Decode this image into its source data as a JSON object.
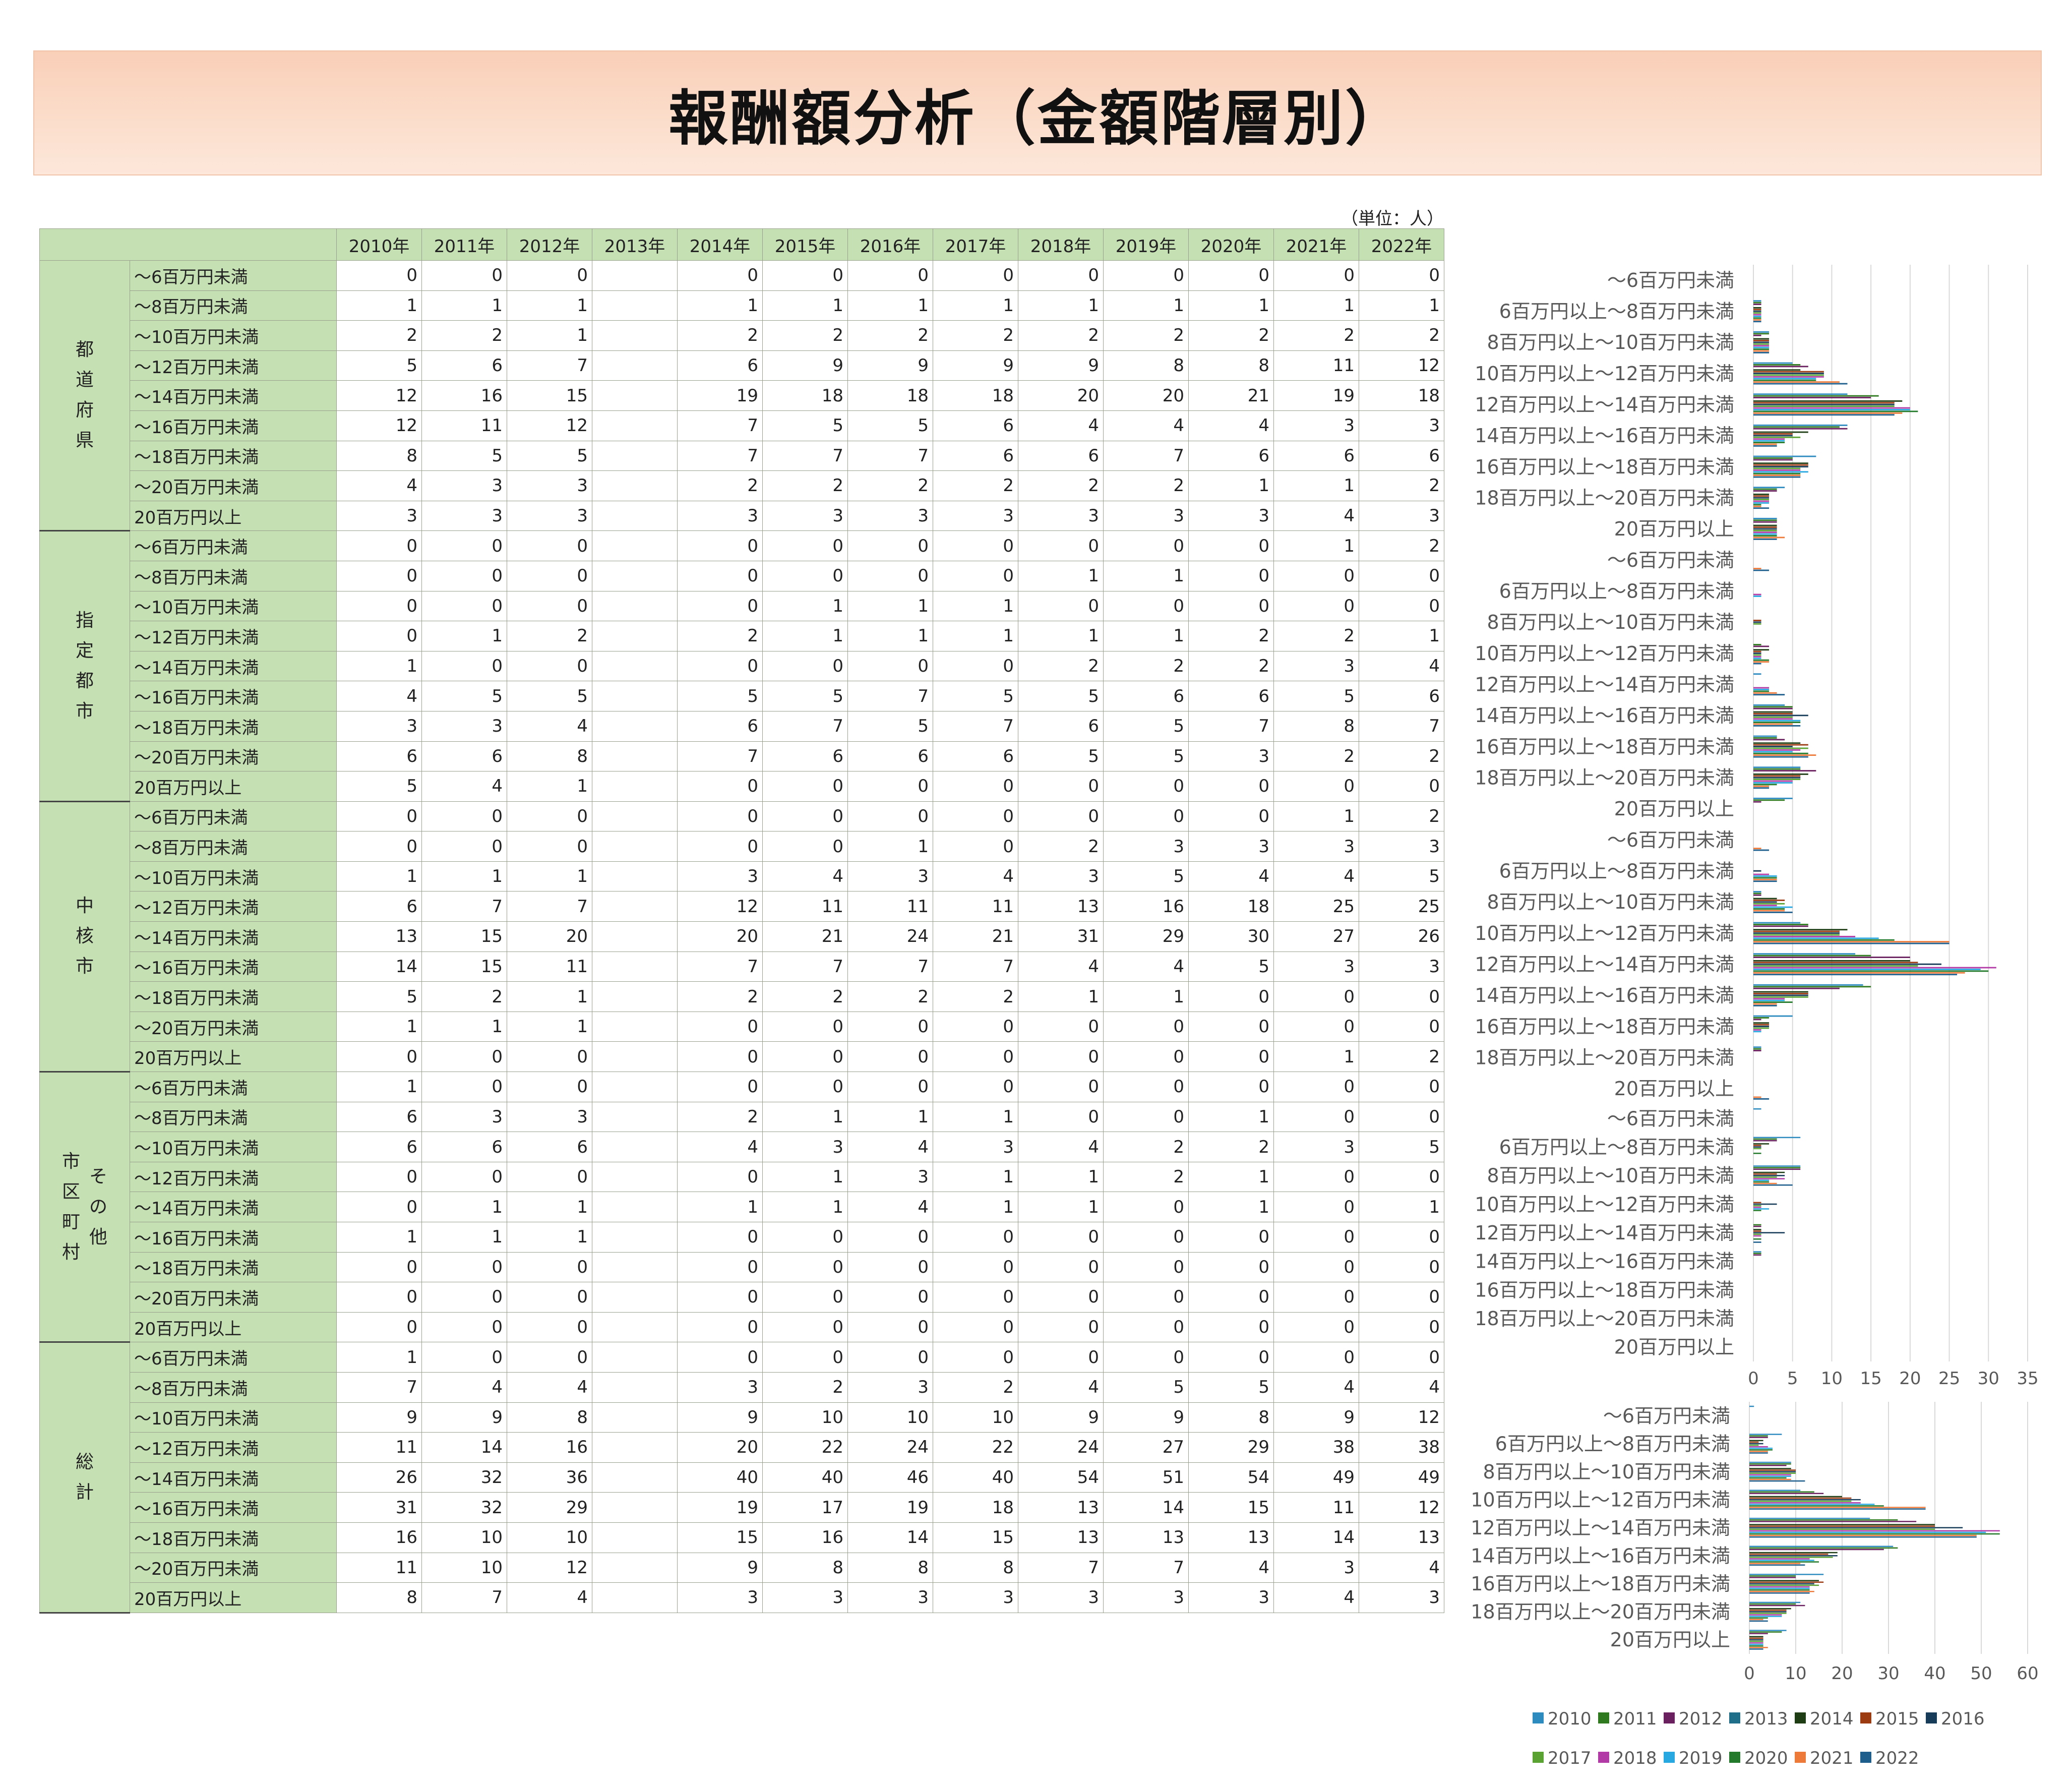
{
  "title": "報酬額分析（金額階層別）",
  "unit_note": "（単位：人）",
  "table": {
    "years": [
      "2010年",
      "2011年",
      "2012年",
      "2013年",
      "2014年",
      "2015年",
      "2016年",
      "2017年",
      "2018年",
      "2019年",
      "2020年",
      "2021年",
      "2022年"
    ],
    "regions": [
      {
        "label": "都道府県",
        "lines": [
          "都",
          "道",
          "府",
          "県"
        ],
        "bands": [
          "～6百万円未満",
          "～8百万円未満",
          "～10百万円未満",
          "～12百万円未満",
          "～14百万円未満",
          "～16百万円未満",
          "～18百万円未満",
          "～20百万円未満",
          "20百万円以上"
        ],
        "rows": [
          [
            "0",
            "0",
            "0",
            "",
            "0",
            "0",
            "0",
            "0",
            "0",
            "0",
            "0",
            "0",
            "0"
          ],
          [
            "1",
            "1",
            "1",
            "",
            "1",
            "1",
            "1",
            "1",
            "1",
            "1",
            "1",
            "1",
            "1"
          ],
          [
            "2",
            "2",
            "1",
            "",
            "2",
            "2",
            "2",
            "2",
            "2",
            "2",
            "2",
            "2",
            "2"
          ],
          [
            "5",
            "6",
            "7",
            "",
            "6",
            "9",
            "9",
            "9",
            "9",
            "8",
            "8",
            "11",
            "12"
          ],
          [
            "12",
            "16",
            "15",
            "",
            "19",
            "18",
            "18",
            "18",
            "20",
            "20",
            "21",
            "19",
            "18"
          ],
          [
            "12",
            "11",
            "12",
            "",
            "7",
            "5",
            "5",
            "6",
            "4",
            "4",
            "4",
            "3",
            "3"
          ],
          [
            "8",
            "5",
            "5",
            "",
            "7",
            "7",
            "7",
            "6",
            "6",
            "7",
            "6",
            "6",
            "6"
          ],
          [
            "4",
            "3",
            "3",
            "",
            "2",
            "2",
            "2",
            "2",
            "2",
            "2",
            "1",
            "1",
            "2"
          ],
          [
            "3",
            "3",
            "3",
            "",
            "3",
            "3",
            "3",
            "3",
            "3",
            "3",
            "3",
            "4",
            "3"
          ]
        ]
      },
      {
        "label": "指定都市",
        "lines": [
          "指",
          "定",
          "都",
          "市"
        ],
        "bands": [
          "～6百万円未満",
          "～8百万円未満",
          "～10百万円未満",
          "～12百万円未満",
          "～14百万円未満",
          "～16百万円未満",
          "～18百万円未満",
          "～20百万円未満",
          "20百万円以上"
        ],
        "rows": [
          [
            "0",
            "0",
            "0",
            "",
            "0",
            "0",
            "0",
            "0",
            "0",
            "0",
            "0",
            "1",
            "2"
          ],
          [
            "0",
            "0",
            "0",
            "",
            "0",
            "0",
            "0",
            "0",
            "1",
            "1",
            "0",
            "0",
            "0"
          ],
          [
            "0",
            "0",
            "0",
            "",
            "0",
            "1",
            "1",
            "1",
            "0",
            "0",
            "0",
            "0",
            "0"
          ],
          [
            "0",
            "1",
            "2",
            "",
            "2",
            "1",
            "1",
            "1",
            "1",
            "1",
            "2",
            "2",
            "1"
          ],
          [
            "1",
            "0",
            "0",
            "",
            "0",
            "0",
            "0",
            "0",
            "2",
            "2",
            "2",
            "3",
            "4"
          ],
          [
            "4",
            "5",
            "5",
            "",
            "5",
            "5",
            "7",
            "5",
            "5",
            "6",
            "6",
            "5",
            "6"
          ],
          [
            "3",
            "3",
            "4",
            "",
            "6",
            "7",
            "5",
            "7",
            "6",
            "5",
            "7",
            "8",
            "7"
          ],
          [
            "6",
            "6",
            "8",
            "",
            "7",
            "6",
            "6",
            "6",
            "5",
            "5",
            "3",
            "2",
            "2"
          ],
          [
            "5",
            "4",
            "1",
            "",
            "0",
            "0",
            "0",
            "0",
            "0",
            "0",
            "0",
            "0",
            "0"
          ]
        ]
      },
      {
        "label": "中核市",
        "lines": [
          "中",
          "核",
          "市"
        ],
        "bands": [
          "～6百万円未満",
          "～8百万円未満",
          "～10百万円未満",
          "～12百万円未満",
          "～14百万円未満",
          "～16百万円未満",
          "～18百万円未満",
          "～20百万円未満",
          "20百万円以上"
        ],
        "rows": [
          [
            "0",
            "0",
            "0",
            "",
            "0",
            "0",
            "0",
            "0",
            "0",
            "0",
            "0",
            "1",
            "2"
          ],
          [
            "0",
            "0",
            "0",
            "",
            "0",
            "0",
            "1",
            "0",
            "2",
            "3",
            "3",
            "3",
            "3"
          ],
          [
            "1",
            "1",
            "1",
            "",
            "3",
            "4",
            "3",
            "4",
            "3",
            "5",
            "4",
            "4",
            "5"
          ],
          [
            "6",
            "7",
            "7",
            "",
            "12",
            "11",
            "11",
            "11",
            "13",
            "16",
            "18",
            "25",
            "25"
          ],
          [
            "13",
            "15",
            "20",
            "",
            "20",
            "21",
            "24",
            "21",
            "31",
            "29",
            "30",
            "27",
            "26"
          ],
          [
            "14",
            "15",
            "11",
            "",
            "7",
            "7",
            "7",
            "7",
            "4",
            "4",
            "5",
            "3",
            "3"
          ],
          [
            "5",
            "2",
            "1",
            "",
            "2",
            "2",
            "2",
            "2",
            "1",
            "1",
            "0",
            "0",
            "0"
          ],
          [
            "1",
            "1",
            "1",
            "",
            "0",
            "0",
            "0",
            "0",
            "0",
            "0",
            "0",
            "0",
            "0"
          ],
          [
            "0",
            "0",
            "0",
            "",
            "0",
            "0",
            "0",
            "0",
            "0",
            "0",
            "0",
            "1",
            "2"
          ]
        ]
      },
      {
        "label": "市区町村その他",
        "lines": [
          "市",
          "区",
          "町",
          "村"
        ],
        "lines2": [
          "そ",
          "の",
          "他"
        ],
        "bands": [
          "～6百万円未満",
          "～8百万円未満",
          "～10百万円未満",
          "～12百万円未満",
          "～14百万円未満",
          "～16百万円未満",
          "～18百万円未満",
          "～20百万円未満",
          "20百万円以上"
        ],
        "rows": [
          [
            "1",
            "0",
            "0",
            "",
            "0",
            "0",
            "0",
            "0",
            "0",
            "0",
            "0",
            "0",
            "0"
          ],
          [
            "6",
            "3",
            "3",
            "",
            "2",
            "1",
            "1",
            "1",
            "0",
            "0",
            "1",
            "0",
            "0"
          ],
          [
            "6",
            "6",
            "6",
            "",
            "4",
            "3",
            "4",
            "3",
            "4",
            "2",
            "2",
            "3",
            "5"
          ],
          [
            "0",
            "0",
            "0",
            "",
            "0",
            "1",
            "3",
            "1",
            "1",
            "2",
            "1",
            "0",
            "0"
          ],
          [
            "0",
            "1",
            "1",
            "",
            "1",
            "1",
            "4",
            "1",
            "1",
            "0",
            "1",
            "0",
            "1"
          ],
          [
            "1",
            "1",
            "1",
            "",
            "0",
            "0",
            "0",
            "0",
            "0",
            "0",
            "0",
            "0",
            "0"
          ],
          [
            "0",
            "0",
            "0",
            "",
            "0",
            "0",
            "0",
            "0",
            "0",
            "0",
            "0",
            "0",
            "0"
          ],
          [
            "0",
            "0",
            "0",
            "",
            "0",
            "0",
            "0",
            "0",
            "0",
            "0",
            "0",
            "0",
            "0"
          ],
          [
            "0",
            "0",
            "0",
            "",
            "0",
            "0",
            "0",
            "0",
            "0",
            "0",
            "0",
            "0",
            "0"
          ]
        ]
      },
      {
        "label": "総計",
        "lines": [
          "総",
          "計"
        ],
        "bands": [
          "～6百万円未満",
          "～8百万円未満",
          "～10百万円未満",
          "～12百万円未満",
          "～14百万円未満",
          "～16百万円未満",
          "～18百万円未満",
          "～20百万円未満",
          "20百万円以上"
        ],
        "rows": [
          [
            "1",
            "0",
            "0",
            "",
            "0",
            "0",
            "0",
            "0",
            "0",
            "0",
            "0",
            "0",
            "0"
          ],
          [
            "7",
            "4",
            "4",
            "",
            "3",
            "2",
            "3",
            "2",
            "4",
            "5",
            "5",
            "4",
            "4"
          ],
          [
            "9",
            "9",
            "8",
            "",
            "9",
            "10",
            "10",
            "10",
            "9",
            "9",
            "8",
            "9",
            "12"
          ],
          [
            "11",
            "14",
            "16",
            "",
            "20",
            "22",
            "24",
            "22",
            "24",
            "27",
            "29",
            "38",
            "38"
          ],
          [
            "26",
            "32",
            "36",
            "",
            "40",
            "40",
            "46",
            "40",
            "54",
            "51",
            "54",
            "49",
            "49"
          ],
          [
            "31",
            "32",
            "29",
            "",
            "19",
            "17",
            "19",
            "18",
            "13",
            "14",
            "15",
            "11",
            "12"
          ],
          [
            "16",
            "10",
            "10",
            "",
            "15",
            "16",
            "14",
            "15",
            "13",
            "13",
            "13",
            "14",
            "13"
          ],
          [
            "11",
            "10",
            "12",
            "",
            "9",
            "8",
            "8",
            "8",
            "7",
            "7",
            "4",
            "3",
            "4"
          ],
          [
            "8",
            "7",
            "4",
            "",
            "3",
            "3",
            "3",
            "3",
            "3",
            "3",
            "3",
            "4",
            "3"
          ]
        ]
      }
    ]
  },
  "chart_data": [
    {
      "type": "bar",
      "orientation": "horizontal",
      "panel": "都道府県",
      "categories": [
        "～6百万円未満",
        "6百万円以上～8百万円未満",
        "8百万円以上～10百万円未満",
        "10百万円以上～12百万円未満",
        "12百万円以上～14百万円未満",
        "14百万円以上～16百万円未満",
        "16百万円以上～18百万円未満",
        "18百万円以上～20百万円未満",
        "20百万円以上"
      ],
      "xlim": [
        0,
        35
      ],
      "xticks": [
        0,
        5,
        10,
        15,
        20,
        25,
        30,
        35
      ],
      "show_tick_labels": true,
      "grid": true
    },
    {
      "type": "bar",
      "orientation": "horizontal",
      "panel": "指定都市",
      "categories": [
        "～6百万円未満",
        "6百万円以上～8百万円未満",
        "8百万円以上～10百万円未満",
        "10百万円以上～12百万円未満",
        "12百万円以上～14百万円未満",
        "14百万円以上～16百万円未満",
        "16百万円以上～18百万円未満",
        "18百万円以上～20百万円未満",
        "20百万円以上"
      ],
      "xlim": [
        0,
        35
      ],
      "xticks": [
        0,
        5,
        10,
        15,
        20,
        25,
        30,
        35
      ],
      "show_tick_labels": false,
      "grid": true
    },
    {
      "type": "bar",
      "orientation": "horizontal",
      "panel": "中核市",
      "categories": [
        "～6百万円未満",
        "6百万円以上～8百万円未満",
        "8百万円以上～10百万円未満",
        "10百万円以上～12百万円未満",
        "12百万円以上～14百万円未満",
        "14百万円以上～16百万円未満",
        "16百万円以上～18百万円未満",
        "18百万円以上～20百万円未満",
        "20百万円以上"
      ],
      "xlim": [
        0,
        35
      ],
      "xticks": [
        0,
        5,
        10,
        15,
        20,
        25,
        30,
        35
      ],
      "show_tick_labels": false,
      "grid": true
    },
    {
      "type": "bar",
      "orientation": "horizontal",
      "panel": "市区町村その他",
      "categories": [
        "～6百万円未満",
        "6百万円以上～8百万円未満",
        "8百万円以上～10百万円未満",
        "10百万円以上～12百万円未満",
        "12百万円以上～14百万円未満",
        "14百万円以上～16百万円未満",
        "16百万円以上～18百万円未満",
        "18百万円以上～20百万円未満",
        "20百万円以上"
      ],
      "xlim": [
        0,
        35
      ],
      "xticks": [
        0,
        5,
        10,
        15,
        20,
        25,
        30,
        35
      ],
      "show_tick_labels": true,
      "grid": true
    },
    {
      "type": "bar",
      "orientation": "horizontal",
      "panel": "総計",
      "categories": [
        "～6百万円未満",
        "6百万円以上～8百万円未満",
        "8百万円以上～10百万円未満",
        "10百万円以上～12百万円未満",
        "12百万円以上～14百万円未満",
        "14百万円以上～16百万円未満",
        "16百万円以上～18百万円未満",
        "18百万円以上～20百万円未満",
        "20百万円以上"
      ],
      "xlim": [
        0,
        60
      ],
      "xticks": [
        0,
        10,
        20,
        30,
        40,
        50,
        60
      ],
      "show_tick_labels": true,
      "grid": true
    }
  ],
  "legend": {
    "placement": "bottom",
    "items": [
      {
        "name": "2010",
        "color": "#2e8bc0"
      },
      {
        "name": "2011",
        "color": "#2f7a1f"
      },
      {
        "name": "2012",
        "color": "#6a1f5e"
      },
      {
        "name": "2013",
        "color": "#1f6f8b"
      },
      {
        "name": "2014",
        "color": "#1e3d14"
      },
      {
        "name": "2015",
        "color": "#9c3a12"
      },
      {
        "name": "2016",
        "color": "#173c5a"
      },
      {
        "name": "2017",
        "color": "#5aa332"
      },
      {
        "name": "2018",
        "color": "#b23aa6"
      },
      {
        "name": "2019",
        "color": "#27a8e0"
      },
      {
        "name": "2020",
        "color": "#237a2a"
      },
      {
        "name": "2021",
        "color": "#ee7a3a"
      },
      {
        "name": "2022",
        "color": "#1d5e8c"
      }
    ]
  }
}
